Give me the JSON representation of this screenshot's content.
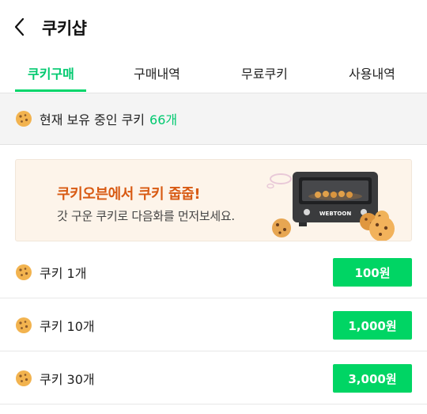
{
  "header": {
    "title": "쿠키샵",
    "back_icon": "chevron-left-icon"
  },
  "tabs": [
    {
      "label": "쿠키구매",
      "active": true
    },
    {
      "label": "구매내역",
      "active": false
    },
    {
      "label": "무료쿠키",
      "active": false
    },
    {
      "label": "사용내역",
      "active": false
    }
  ],
  "balance": {
    "label": "현재 보유 중인 쿠키",
    "count": "66개",
    "icon": "cookie-icon"
  },
  "banner": {
    "title": "쿠키오븐에서 쿠키 줍줍!",
    "subtitle": "갓 구운 쿠키로 다음화를 먼저보세요.",
    "oven_brand": "WEBTOON"
  },
  "products": [
    {
      "label": "쿠키 1개",
      "price": "100원"
    },
    {
      "label": "쿠키 10개",
      "price": "1,000원"
    },
    {
      "label": "쿠키 30개",
      "price": "3,000원"
    }
  ],
  "colors": {
    "accent": "#00d564",
    "banner_title": "#d85a13",
    "banner_bg": "#fdf4ea"
  }
}
